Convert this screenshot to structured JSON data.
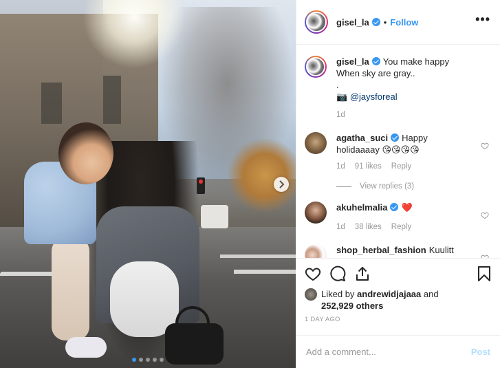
{
  "header": {
    "username": "gisel_la",
    "follow_label": "Follow",
    "bullet": "•"
  },
  "caption": {
    "username": "gisel_la",
    "line1": "You make happy",
    "line2": "When sky are gray..",
    "line3": ".",
    "camera_emoji": "📷",
    "mention": "@jaysforeal",
    "time": "1d"
  },
  "comments": [
    {
      "username": "agatha_suci",
      "verified": true,
      "text_line1": "Happy",
      "text_line2": "holidaaaay 😘😘😘😘",
      "time": "1d",
      "likes": "91 likes",
      "reply": "Reply",
      "view_replies": "View replies (3)"
    },
    {
      "username": "akuhelmalia",
      "verified": true,
      "text": "❤️",
      "time": "1d",
      "likes": "38 likes",
      "reply": "Reply"
    },
    {
      "username": "shop_herbal_fashion",
      "text": "Kuulitt"
    }
  ],
  "likes": {
    "prefix": "Liked by ",
    "user": "andrewidjajaaa",
    "and": " and",
    "count": "252,929 others"
  },
  "timestamp": "1 DAY AGO",
  "add_comment": {
    "placeholder": "Add a comment...",
    "post_label": "Post"
  },
  "carousel": {
    "total": 5,
    "active": 1
  },
  "icons": [
    "heart-icon",
    "comment-icon",
    "share-icon",
    "bookmark-icon",
    "more-icon",
    "chevron-right-icon",
    "verified-icon"
  ],
  "colors": {
    "accent": "#3897f0",
    "muted": "#999999",
    "border": "#efefef",
    "heart_red": "#ed4956"
  }
}
